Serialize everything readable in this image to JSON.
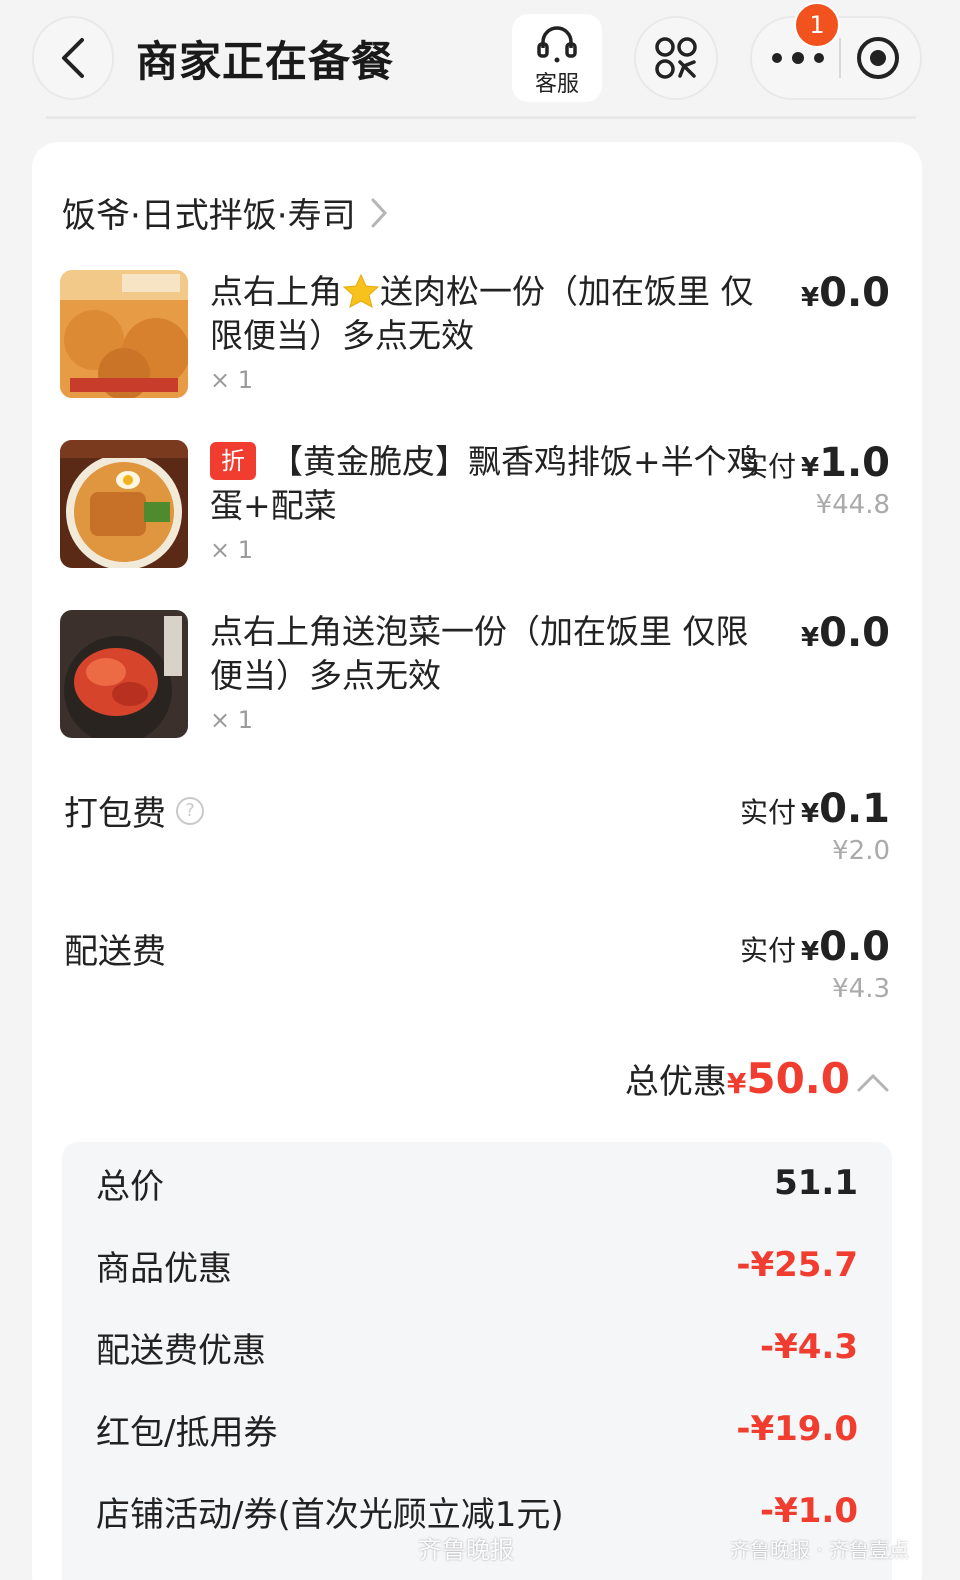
{
  "header": {
    "title": "商家正在备餐",
    "customer_service_label": "客服",
    "notification_count": "1",
    "back_icon": "chevron-left-icon",
    "more_icon": "more-dots-icon",
    "close_icon": "target-circle-icon"
  },
  "shop": {
    "name": "饭爷·日式拌饭·寿司"
  },
  "items": [
    {
      "name_part1": "点右上角",
      "name_part2": "送肉松一份（加在饭里 仅限便当）多点无效",
      "qty": "× 1",
      "yen": "¥",
      "price": "0.0",
      "thumb_colors": [
        "#f0a54a",
        "#c7742a"
      ]
    },
    {
      "tag": "折",
      "name": "【黄金脆皮】飘香鸡排饭+半个鸡蛋+配菜",
      "qty": "× 1",
      "paid_label": "实付",
      "yen": "¥",
      "price": "1.0",
      "original_price": "¥44.8",
      "thumb_colors": [
        "#d7853a",
        "#8f4a22"
      ]
    },
    {
      "name": "点右上角送泡菜一份（加在饭里 仅限便当）多点无效",
      "qty": "× 1",
      "yen": "¥",
      "price": "0.0",
      "thumb_colors": [
        "#e0553a",
        "#b73223"
      ]
    }
  ],
  "fees": {
    "packing": {
      "label": "打包费",
      "paid_label": "实付",
      "yen": "¥",
      "price": "0.1",
      "original_price": "¥2.0"
    },
    "delivery": {
      "label": "配送费",
      "paid_label": "实付",
      "yen": "¥",
      "price": "0.0",
      "original_price": "¥4.3"
    }
  },
  "total_discount": {
    "label": "总优惠",
    "yen": "¥",
    "amount": "50.0"
  },
  "summary": [
    {
      "label": "总价",
      "value": "51.1"
    },
    {
      "label": "商品优惠",
      "value": "-¥25.7"
    },
    {
      "label": "配送费优惠",
      "value": "-¥4.3"
    },
    {
      "label": "红包/抵用券",
      "value": "-¥19.0"
    },
    {
      "label": "店铺活动/券(首次光顾立减1元)",
      "value": "-¥1.0"
    }
  ],
  "watermarks": {
    "left": "齐鲁晚报",
    "right": "齐鲁晚报 · 齐鲁壹点"
  },
  "colors": {
    "accent_red": "#f03d2f",
    "badge_orange": "#f2531e"
  }
}
